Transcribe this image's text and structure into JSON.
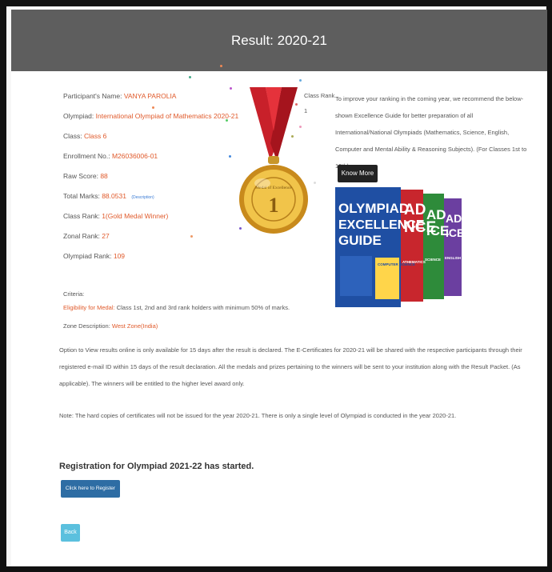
{
  "header": {
    "title": "Result: 2020-21"
  },
  "participant": {
    "name_label": "Participant's Name:",
    "name": "VANYA PAROLIA",
    "olympiad_label": "Olympiad:",
    "olympiad": "International Olympiad of Mathematics 2020-21",
    "class_label": "Class:",
    "class": "Class 6",
    "enrollment_label": "Enrollment No.:",
    "enrollment": "M26036006-01",
    "raw_score_label": "Raw Score:",
    "raw_score": "88",
    "total_marks_label": "Total Marks:",
    "total_marks": "88.0531",
    "description_link": "(Description)",
    "class_rank_label": "Class Rank:",
    "class_rank": "1(Gold Medal Winner)",
    "zonal_rank_label": "Zonal Rank:",
    "zonal_rank": "27",
    "olympiad_rank_label": "Olympiad Rank:",
    "olympiad_rank": "109"
  },
  "criteria": {
    "title": "Criteria:",
    "eligibility_label": "Eligibility for Medal:",
    "eligibility_text": "Class 1st, 2nd and 3rd rank holders with minimum 50% of marks.",
    "zone_label": "Zone Description:",
    "zone": "West Zone(India)"
  },
  "rank_column": {
    "header": "Class Rank",
    "value": "1"
  },
  "recommendation": {
    "text": "To improve your ranking in the coming year, we recommend the below-shown Excellence Guide for better preparation of all International/National Olympiads (Mathematics, Science, English, Computer and Mental Ability & Reasoning Subjects). (For Classes 1st to 10th).",
    "button": "Know More"
  },
  "books": {
    "title_line1": "OLYMPIAD",
    "title_line2": "EXCELLENCE",
    "title_line3": "GUIDE",
    "subjects": [
      "COMPUTER SCIENCE",
      "ATHEMATICS",
      "SCIENCE",
      "ENGLISH"
    ],
    "colors": {
      "blue": "#1f4fa3",
      "red": "#c8262d",
      "green": "#2e8b3a",
      "purple": "#6b3fa0"
    }
  },
  "notes": {
    "para1": "Option to View results online is only available for 15 days after the result is declared. The E-Certificates for 2020-21 will be shared with the respective participants through their registered e-mail ID within 15 days of the result declaration. All the medals and prizes pertaining to the winners will be sent to your institution along with the Result Packet. (As applicable). The winners will be entitled to the higher level award only.",
    "para2": "Note: The hard copies of certificates will not be issued for the year 2020-21. There is only a single level of Olympiad is conducted in the year 2020-21."
  },
  "registration": {
    "title": "Registration for Olympiad 2021-22 has started.",
    "button": "Click here to Register",
    "back": "Back"
  },
  "medal": {
    "ribbon_color": "#c8202a",
    "gold_color": "#e2a92b",
    "text": "Medal of Excellence",
    "numeral": "1"
  }
}
